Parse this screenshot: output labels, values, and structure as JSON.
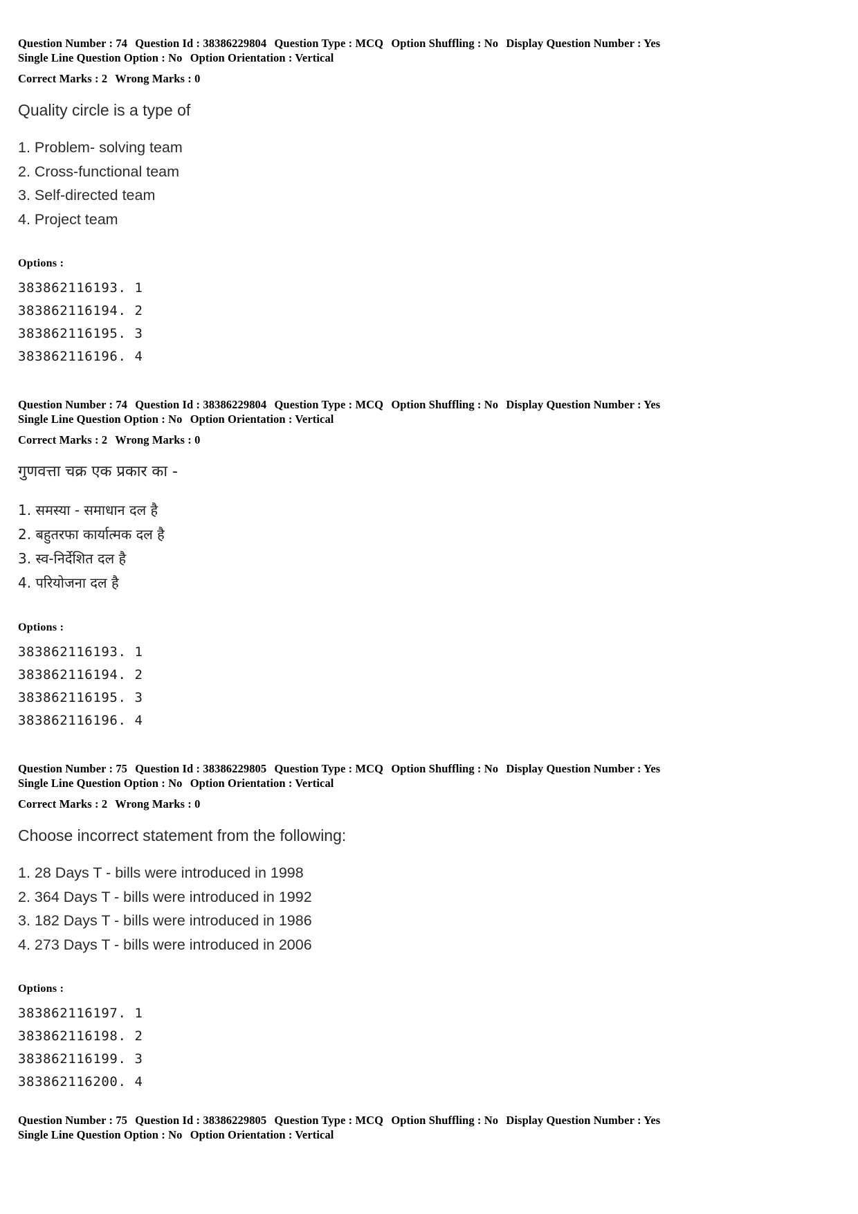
{
  "document": {
    "type": "exam-answer-key-page",
    "page_background": "#ffffff",
    "text_color": "#2b2b2b"
  },
  "labels": {
    "question_number": "Question Number :",
    "question_id": "Question Id :",
    "question_type": "Question Type :",
    "option_shuffling": "Option Shuffling :",
    "display_question_number": "Display Question Number :",
    "single_line_question_option": "Single Line Question Option :",
    "option_orientation": "Option Orientation :",
    "correct_marks": "Correct Marks :",
    "wrong_marks": "Wrong Marks :",
    "options_heading": "Options :"
  },
  "blocks": [
    {
      "id": "q74-en",
      "meta": {
        "question_number": "74",
        "question_id": "38386229804",
        "question_type": "MCQ",
        "option_shuffling": "No",
        "display_question_number": "Yes",
        "single_line_question_option": "No",
        "option_orientation": "Vertical",
        "correct_marks": "2",
        "wrong_marks": "0"
      },
      "question_text": "Quality circle is a type of",
      "language": "en",
      "options": [
        "1. Problem- solving team",
        "2. Cross-functional team",
        "3. Self-directed team",
        "4. Project team"
      ],
      "option_ids": [
        "383862116193. 1",
        "383862116194. 2",
        "383862116195. 3",
        "383862116196. 4"
      ]
    },
    {
      "id": "q74-hi",
      "meta": {
        "question_number": "74",
        "question_id": "38386229804",
        "question_type": "MCQ",
        "option_shuffling": "No",
        "display_question_number": "Yes",
        "single_line_question_option": "No",
        "option_orientation": "Vertical",
        "correct_marks": "2",
        "wrong_marks": "0"
      },
      "question_text": "गुणवत्ता चक्र एक प्रकार का -",
      "language": "hi",
      "options": [
        "1. समस्या - समाधान दल है",
        "2. बहुतरफा कार्यात्मक दल है",
        "3. स्व-निर्देशित दल है",
        "4. परियोजना दल है"
      ],
      "option_ids": [
        "383862116193. 1",
        "383862116194. 2",
        "383862116195. 3",
        "383862116196. 4"
      ]
    },
    {
      "id": "q75-en",
      "meta": {
        "question_number": "75",
        "question_id": "38386229805",
        "question_type": "MCQ",
        "option_shuffling": "No",
        "display_question_number": "Yes",
        "single_line_question_option": "No",
        "option_orientation": "Vertical",
        "correct_marks": "2",
        "wrong_marks": "0"
      },
      "question_text": "Choose incorrect statement from the following:",
      "language": "en",
      "options": [
        "1. 28 Days T - bills were introduced in 1998",
        "2. 364 Days T - bills were introduced in 1992",
        "3. 182 Days T - bills were introduced in 1986",
        "4. 273 Days T - bills were introduced in 2006"
      ],
      "option_ids": [
        "383862116197. 1",
        "383862116198. 2",
        "383862116199. 3",
        "383862116200. 4"
      ]
    }
  ],
  "footer_partial": {
    "meta": {
      "question_number": "75",
      "question_id": "38386229805",
      "question_type": "MCQ",
      "option_shuffling": "No",
      "display_question_number": "Yes",
      "single_line_question_option": "No",
      "option_orientation": "Vertical"
    }
  }
}
